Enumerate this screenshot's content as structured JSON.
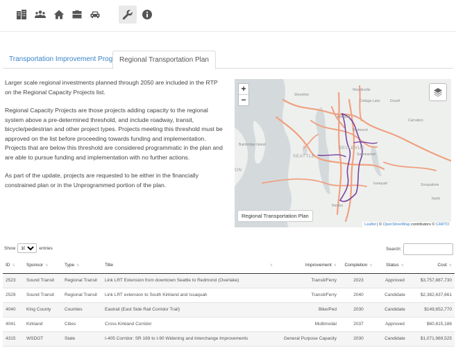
{
  "toolbar": {
    "icons": [
      "building-icon",
      "people-icon",
      "home-icon",
      "briefcase-icon",
      "car-icon",
      "wrench-icon",
      "info-icon"
    ],
    "active_icon": "wrench-icon"
  },
  "tabs": [
    {
      "label": "Transportation Improvement Program",
      "active": false
    },
    {
      "label": "Regional Transportation Plan",
      "active": true
    }
  ],
  "description": [
    "Larger scale regional investments planned through 2050 are included in the RTP on the Regional Capacity Projects list.",
    "Regional Capacity Projects are those projects adding capacity to the regional system above a pre-determined threshold, and include roadway, transit, bicycle/pedestrian and other project types. Projects meeting this threshold must be approved on the list before proceeding towards funding and implementation. Projects that are below this threshold are considered programmatic in the plan and are able to pursue funding and implementation with no further actions.",
    "As part of the update, projects are requested to be either in the financially constrained plan or in the Unprogrammed portion of the plan."
  ],
  "map": {
    "zoom_in": "+",
    "zoom_out": "−",
    "layer_label": "Regional Transportation Plan",
    "attribution_leaflet": "Leaflet",
    "attribution_sep": " | © ",
    "attribution_osm": "OpenStreetMap",
    "attribution_rest": " contributors © ",
    "attribution_carto": "CARTO",
    "places": {
      "shoreline": "Shoreline",
      "woodinville": "Woodinville",
      "cottage_lake": "Cottage Lake",
      "duvall": "Duvall",
      "kirkland": "Kirkland",
      "redmond": "Redmond",
      "carnation": "Carnation",
      "bainbridge": "Bainbridge Island",
      "seattle": "SEATTLE",
      "bellevue": "BELLEVUE",
      "sammamish": "Sammamish",
      "on": "ON",
      "issaquah": "Issaquah",
      "snoqualmie": "Snoqualmie",
      "north": "North",
      "renton": "Renton"
    },
    "colors": {
      "water": "#d4dadc",
      "land": "#eef0ee",
      "rtp_line": "#f0a080",
      "highlight": "#7b3fa0"
    }
  },
  "table_controls": {
    "show_label": "Show",
    "entries_value": "10",
    "entries_label": "entries",
    "search_label": "Search:",
    "search_value": ""
  },
  "table": {
    "headers": [
      "ID",
      "Sponsor",
      "Type",
      "Title",
      "Improvement",
      "Completion",
      "Status",
      "Cost"
    ],
    "rows": [
      [
        "2523",
        "Sound Transit",
        "Regional Transit",
        "Link LRT Extension from downtown Seattle to Redmond (Overlake)",
        "Transit/Ferry",
        "2023",
        "Approved",
        "$3,757,887,730"
      ],
      [
        "2529",
        "Sound Transit",
        "Regional Transit",
        "Link LRT extension to South Kirkland and Issaquah",
        "Transit/Ferry",
        "2040",
        "Candidate",
        "$2,382,637,661"
      ],
      [
        "4040",
        "King County",
        "Counties",
        "Eastrail (East Side Rail Corridor Trail)",
        "Bike/Ped",
        "2030",
        "Candidate",
        "$149,652,770"
      ],
      [
        "4041",
        "Kirkland",
        "Cities",
        "Cross Kirkland Corridor",
        "Multimodal",
        "2037",
        "Approved",
        "$60,815,186"
      ],
      [
        "4315",
        "WSDOT",
        "State",
        "I-405 Corridor: SR 169 to I-90 Widening and Interchange Improvements",
        "General Purpose Capacity",
        "2030",
        "Candidate",
        "$1,071,969,525"
      ]
    ]
  }
}
